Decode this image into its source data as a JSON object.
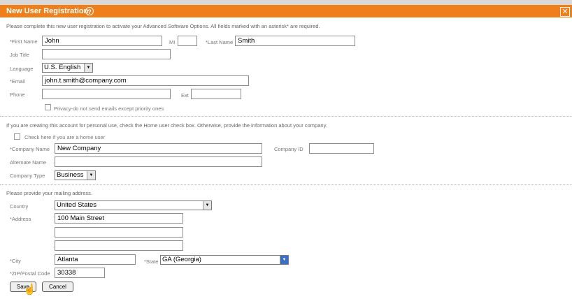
{
  "window": {
    "title": "New User Registration",
    "help_glyph": "?",
    "close_glyph": "✕"
  },
  "intro": "Please complete this new user registration to activate your Advanced Software Options. All fields marked with an asterisk* are required.",
  "user": {
    "first_name_label": "*First Name",
    "first_name": "John",
    "mi_label": "MI",
    "mi": "",
    "last_name_label": "*Last Name",
    "last_name": "Smith",
    "job_title_label": "Job Title",
    "job_title": "",
    "language_label": "Language",
    "language": "U.S. English",
    "email_label": "*Email",
    "email": "john.t.smith@company.com",
    "phone_label": "Phone",
    "phone": "",
    "ext_label": "Ext",
    "ext": "",
    "privacy_label": "Privacy-do not send emails except priority ones"
  },
  "company": {
    "intro": "If you are creating this account for personal use, check the Home user check box. Otherwise, provide the information about your company.",
    "home_user_label": "Check here if you are a home user",
    "company_name_label": "*Company Name",
    "company_name": "New Company",
    "company_id_label": "Company ID",
    "company_id": "",
    "alternate_name_label": "Alternate Name",
    "alternate_name": "",
    "company_type_label": "Company Type",
    "company_type": "Business"
  },
  "address": {
    "intro": "Please provide your mailing address.",
    "country_label": "Country",
    "country": "United States",
    "address_label": "*Address",
    "address1": "100 Main Street",
    "address2": "",
    "address3": "",
    "city_label": "*City",
    "city": "Atlanta",
    "state_label": "*State",
    "state": "GA (Georgia)",
    "zip_label": "*ZIP/Postal Code",
    "zip": "30338"
  },
  "buttons": {
    "save": "Save",
    "cancel": "Cancel"
  },
  "colors": {
    "title_bar": "#ef7f1a",
    "select_arrow_accent": "#3a6fc4"
  },
  "icons": {
    "help": "help-icon",
    "close": "close-icon",
    "cursor": "hand-pointer-icon"
  }
}
